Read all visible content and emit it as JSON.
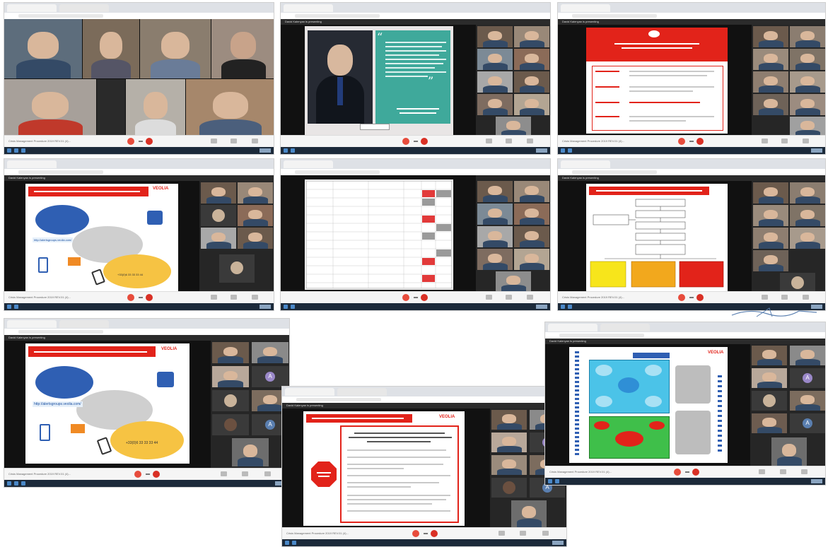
{
  "meeting": {
    "presenting_label": "David Kalenyan is presenting",
    "footer_file": "Crisis Management Procedure 2019 REV.01 (4)...",
    "stop_label": "Stop presenting",
    "url_text": "meet.google.com"
  },
  "slide_titles": {
    "crisis_title": "ՃԳՆԱԺԱՄԱՅԻՆ ԻՐԱՎԻՃԱԿՆԵՐԻ ԿԱՌԱՎԱՐՈՒՄ",
    "comm_title": "ԻՆՖՈՐՄԱՑԻԱՅԻ ՏԱՐԱԾՈՒՄ",
    "diagram_title": "ՃԳՆԱԺԱՄԱՅԻՆ ԻՐԱՎԻՃԱԿՆԵՐԻ ԿԱՌԱՎԱՐՄԱՆ ՍԽԵՄԱ",
    "brand": "VEOLIA",
    "link": "http://alertsgroups.veolia.com/",
    "phone": "+33(0)6 33 33 33 44",
    "quote_mark_open": "“",
    "quote_mark_close": "”"
  },
  "colors": {
    "brand_red": "#e2231a",
    "teal": "#3fa99b",
    "end_call": "#d93025",
    "bg_dark": "#1f1f1f"
  }
}
